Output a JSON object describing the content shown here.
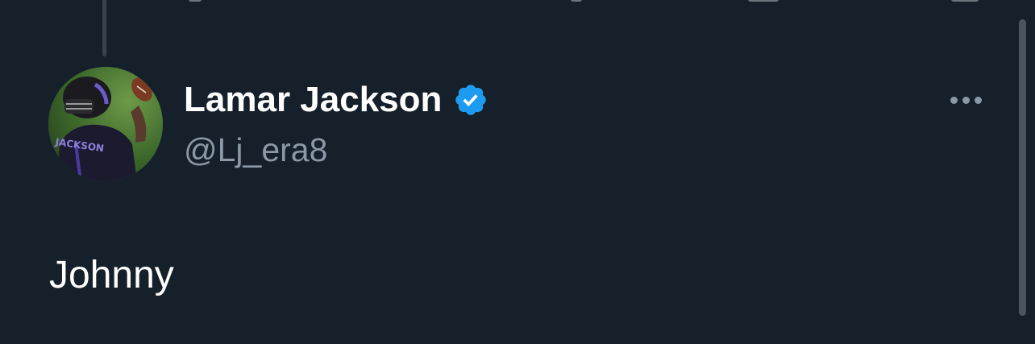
{
  "tweet": {
    "author_name": "Lamar Jackson",
    "author_handle": "@Lj_era8",
    "text": "Johnny",
    "verified": true
  },
  "avatar": {
    "jersey_text": "JACKSON",
    "description_icon": "avatar-photo"
  },
  "icons": {
    "verified": "verified-badge-icon",
    "more": "more-options-icon"
  },
  "colors": {
    "background": "#15202b",
    "primary_text": "#ffffff",
    "secondary_text": "#8b98a5",
    "verified_blue": "#1d9bf0",
    "thread_line": "#38444d"
  }
}
